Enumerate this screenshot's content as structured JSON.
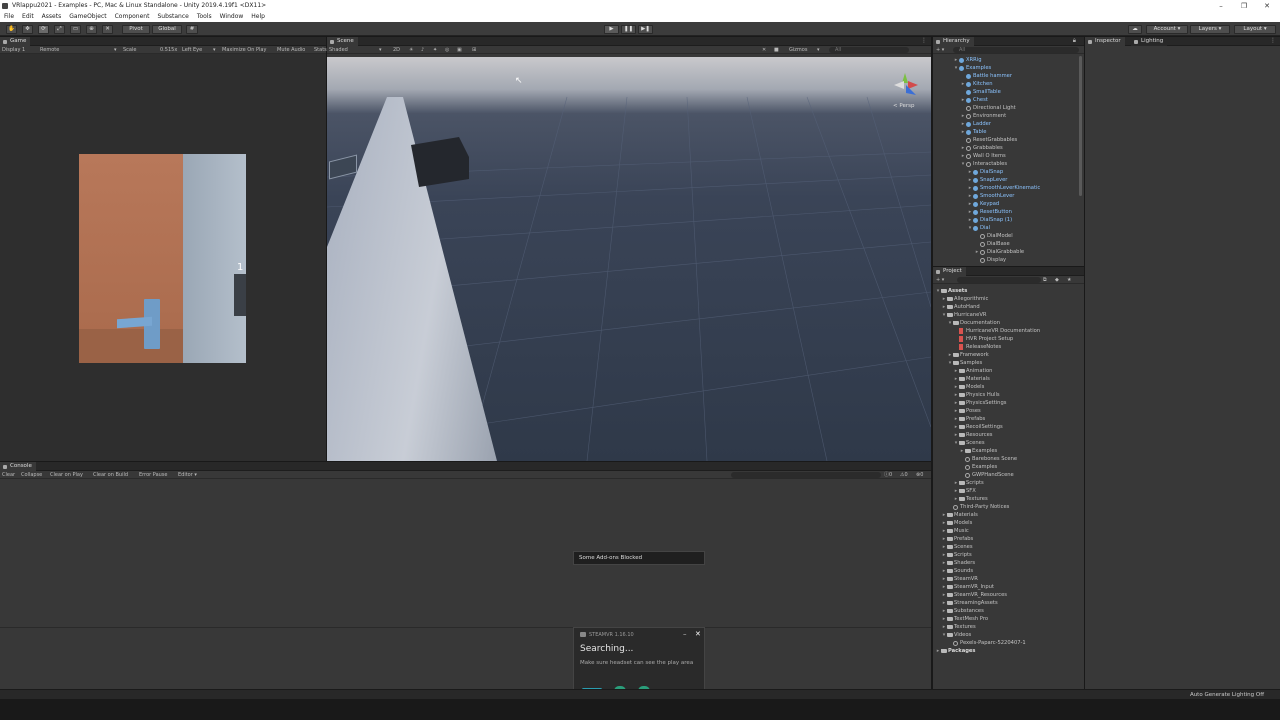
{
  "window": {
    "title": "VRlappu2021 - Examples - PC, Mac & Linux Standalone - Unity 2019.4.19f1 <DX11>"
  },
  "menu": [
    "File",
    "Edit",
    "Assets",
    "GameObject",
    "Component",
    "Substance",
    "Tools",
    "Window",
    "Help"
  ],
  "toolbar": {
    "pivot": "Pivot",
    "global": "Global",
    "account": "Account",
    "layers": "Layers",
    "layout": "Layout"
  },
  "game": {
    "tab": "Game",
    "display": "Display 1",
    "remote": "Remote",
    "scale_label": "Scale",
    "scale_value": "0.515x",
    "left_eye": "Left Eye",
    "maximize": "Maximize On Play",
    "mute": "Mute Audio",
    "stats": "Stats",
    "hand_count": "1"
  },
  "scene": {
    "tab": "Scene",
    "shading": "Shaded",
    "mode": "2D",
    "gizmos": "Gizmos",
    "search_placeholder": "All",
    "persp": "< Persp"
  },
  "hierarchy": {
    "tab": "Hierarchy",
    "search_placeholder": "All",
    "items": [
      {
        "label": "XRRig",
        "indent": 0,
        "arrow": "▸",
        "icon": "cube"
      },
      {
        "label": "Examples",
        "indent": 0,
        "arrow": "▾",
        "icon": "cube"
      },
      {
        "label": "Battle hammer",
        "indent": 1,
        "arrow": "",
        "icon": "cube"
      },
      {
        "label": "Kitchen",
        "indent": 1,
        "arrow": "▸",
        "icon": "cube"
      },
      {
        "label": "SmallTable",
        "indent": 1,
        "arrow": "",
        "icon": "cube"
      },
      {
        "label": "Chest",
        "indent": 1,
        "arrow": "▸",
        "icon": "cube"
      },
      {
        "label": "Directional Light",
        "indent": 1,
        "arrow": "",
        "icon": "grey"
      },
      {
        "label": "Environment",
        "indent": 1,
        "arrow": "▸",
        "icon": "grey"
      },
      {
        "label": "Ladder",
        "indent": 1,
        "arrow": "▸",
        "icon": "cube"
      },
      {
        "label": "Table",
        "indent": 1,
        "arrow": "▸",
        "icon": "cube"
      },
      {
        "label": "ResetGrabbables",
        "indent": 1,
        "arrow": "",
        "icon": "grey"
      },
      {
        "label": "Grabbables",
        "indent": 1,
        "arrow": "▸",
        "icon": "grey"
      },
      {
        "label": "Wall O Items",
        "indent": 1,
        "arrow": "▸",
        "icon": "grey"
      },
      {
        "label": "Interactables",
        "indent": 1,
        "arrow": "▾",
        "icon": "grey"
      },
      {
        "label": "DialSnap",
        "indent": 2,
        "arrow": "▸",
        "icon": "cube"
      },
      {
        "label": "SnapLever",
        "indent": 2,
        "arrow": "▸",
        "icon": "cube"
      },
      {
        "label": "SmoothLeverKinematic",
        "indent": 2,
        "arrow": "▸",
        "icon": "cube"
      },
      {
        "label": "SmoothLever",
        "indent": 2,
        "arrow": "▸",
        "icon": "cube"
      },
      {
        "label": "Keypad",
        "indent": 2,
        "arrow": "▸",
        "icon": "cube"
      },
      {
        "label": "ResetButton",
        "indent": 2,
        "arrow": "▸",
        "icon": "cube"
      },
      {
        "label": "DialSnap (1)",
        "indent": 2,
        "arrow": "▸",
        "icon": "cube"
      },
      {
        "label": "Dial",
        "indent": 2,
        "arrow": "▾",
        "icon": "cube"
      },
      {
        "label": "DialModel",
        "indent": 3,
        "arrow": "",
        "icon": "grey"
      },
      {
        "label": "DialBase",
        "indent": 3,
        "arrow": "",
        "icon": "grey"
      },
      {
        "label": "DialGrabbable",
        "indent": 3,
        "arrow": "▸",
        "icon": "grey"
      },
      {
        "label": "Display",
        "indent": 3,
        "arrow": "",
        "icon": "grey"
      }
    ]
  },
  "inspector": {
    "tab": "Inspector",
    "lighting_tab": "Lighting"
  },
  "project": {
    "tab": "Project",
    "items": [
      {
        "label": "Assets",
        "indent": 0,
        "arrow": "▾",
        "icon": "folder",
        "bold": true
      },
      {
        "label": "Allegorithmic",
        "indent": 1,
        "arrow": "▸",
        "icon": "folder"
      },
      {
        "label": "AutoHand",
        "indent": 1,
        "arrow": "▸",
        "icon": "folder"
      },
      {
        "label": "HurricaneVR",
        "indent": 1,
        "arrow": "▾",
        "icon": "folder"
      },
      {
        "label": "Documentation",
        "indent": 2,
        "arrow": "▾",
        "icon": "folder"
      },
      {
        "label": "HurricaneVR Documentation",
        "indent": 3,
        "arrow": "",
        "icon": "file"
      },
      {
        "label": "HVR Project Setup",
        "indent": 3,
        "arrow": "",
        "icon": "file"
      },
      {
        "label": "ReleaseNotes",
        "indent": 3,
        "arrow": "",
        "icon": "file"
      },
      {
        "label": "Framework",
        "indent": 2,
        "arrow": "▸",
        "icon": "folder"
      },
      {
        "label": "Samples",
        "indent": 2,
        "arrow": "▾",
        "icon": "folder"
      },
      {
        "label": "Animation",
        "indent": 3,
        "arrow": "▸",
        "icon": "folder"
      },
      {
        "label": "Materials",
        "indent": 3,
        "arrow": "▸",
        "icon": "folder"
      },
      {
        "label": "Models",
        "indent": 3,
        "arrow": "▸",
        "icon": "folder"
      },
      {
        "label": "Physics Hulls",
        "indent": 3,
        "arrow": "▸",
        "icon": "folder"
      },
      {
        "label": "PhysicsSettings",
        "indent": 3,
        "arrow": "▸",
        "icon": "folder"
      },
      {
        "label": "Poses",
        "indent": 3,
        "arrow": "▸",
        "icon": "folder"
      },
      {
        "label": "Prefabs",
        "indent": 3,
        "arrow": "▸",
        "icon": "folder"
      },
      {
        "label": "RecoilSettings",
        "indent": 3,
        "arrow": "▸",
        "icon": "folder"
      },
      {
        "label": "Resources",
        "indent": 3,
        "arrow": "▸",
        "icon": "folder"
      },
      {
        "label": "Scenes",
        "indent": 3,
        "arrow": "▾",
        "icon": "folder"
      },
      {
        "label": "Examples",
        "indent": 4,
        "arrow": "▸",
        "icon": "folder"
      },
      {
        "label": "Barebones Scene",
        "indent": 4,
        "arrow": "",
        "icon": "scene"
      },
      {
        "label": "Examples",
        "indent": 4,
        "arrow": "",
        "icon": "scene"
      },
      {
        "label": "GWPHandScene",
        "indent": 4,
        "arrow": "",
        "icon": "scene"
      },
      {
        "label": "Scripts",
        "indent": 3,
        "arrow": "▸",
        "icon": "folder"
      },
      {
        "label": "SFX",
        "indent": 3,
        "arrow": "▸",
        "icon": "folder"
      },
      {
        "label": "Textures",
        "indent": 3,
        "arrow": "▸",
        "icon": "folder"
      },
      {
        "label": "Third-Party Notices",
        "indent": 2,
        "arrow": "",
        "icon": "doc"
      },
      {
        "label": "Materials",
        "indent": 1,
        "arrow": "▸",
        "icon": "folder"
      },
      {
        "label": "Models",
        "indent": 1,
        "arrow": "▸",
        "icon": "folder"
      },
      {
        "label": "Music",
        "indent": 1,
        "arrow": "▸",
        "icon": "folder"
      },
      {
        "label": "Prefabs",
        "indent": 1,
        "arrow": "▸",
        "icon": "folder"
      },
      {
        "label": "Scenes",
        "indent": 1,
        "arrow": "▸",
        "icon": "folder"
      },
      {
        "label": "Scripts",
        "indent": 1,
        "arrow": "▸",
        "icon": "folder"
      },
      {
        "label": "Shaders",
        "indent": 1,
        "arrow": "▸",
        "icon": "folder"
      },
      {
        "label": "Sounds",
        "indent": 1,
        "arrow": "▸",
        "icon": "folder"
      },
      {
        "label": "SteamVR",
        "indent": 1,
        "arrow": "▸",
        "icon": "folder"
      },
      {
        "label": "SteamVR_Input",
        "indent": 1,
        "arrow": "▸",
        "icon": "folder"
      },
      {
        "label": "SteamVR_Resources",
        "indent": 1,
        "arrow": "▸",
        "icon": "folder"
      },
      {
        "label": "StreamingAssets",
        "indent": 1,
        "arrow": "▸",
        "icon": "folder"
      },
      {
        "label": "Substances",
        "indent": 1,
        "arrow": "▸",
        "icon": "folder"
      },
      {
        "label": "TextMesh Pro",
        "indent": 1,
        "arrow": "▸",
        "icon": "folder"
      },
      {
        "label": "Textures",
        "indent": 1,
        "arrow": "▸",
        "icon": "folder"
      },
      {
        "label": "Videos",
        "indent": 1,
        "arrow": "▾",
        "icon": "folder"
      },
      {
        "label": "Pexels-Paparc-5220407-1",
        "indent": 2,
        "arrow": "",
        "icon": "doc"
      },
      {
        "label": "Packages",
        "indent": 0,
        "arrow": "▸",
        "icon": "folder",
        "bold": true
      }
    ]
  },
  "console": {
    "tab": "Console",
    "buttons": [
      "Clear",
      "Collapse",
      "Clear on Play",
      "Clear on Build",
      "Error Pause",
      "Editor ▾"
    ],
    "counts": {
      "info": "0",
      "warn": "0",
      "error": "0"
    },
    "toast": "Some Add-ons Blocked"
  },
  "steamvr": {
    "title": "STEAMVR 1.16.10",
    "status": "Searching...",
    "hint": "Make sure headset can see the play area"
  },
  "status": {
    "right": "Auto Generate Lighting Off"
  }
}
